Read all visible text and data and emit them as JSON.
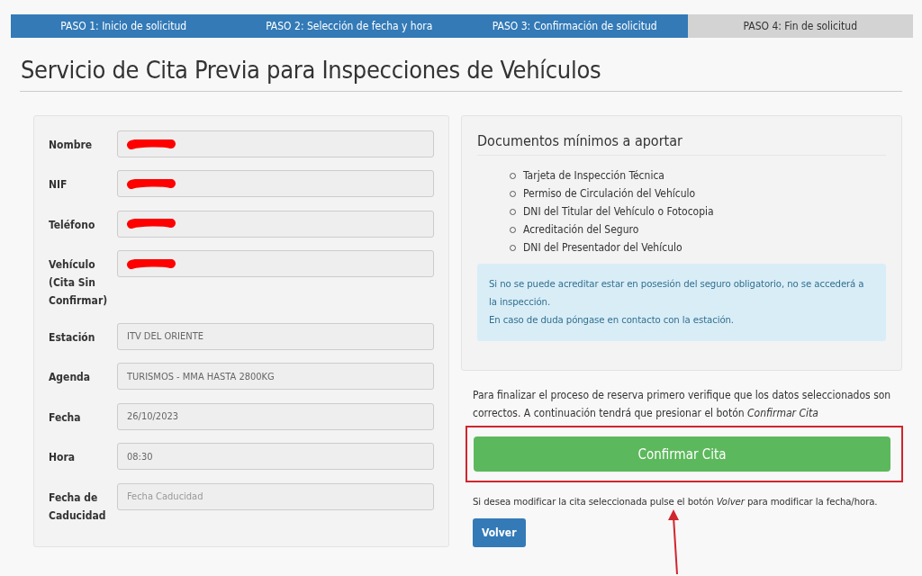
{
  "steps": [
    {
      "label": "PASO 1: Inicio de solicitud",
      "active": true
    },
    {
      "label": "PASO 2: Selección de fecha y hora",
      "active": true
    },
    {
      "label": "PASO 3: Confirmación de solicitud",
      "active": true
    },
    {
      "label": "PASO 4: Fin de solicitud",
      "active": false
    }
  ],
  "title": "Servicio de Cita Previa para Inspecciones de Vehículos",
  "form": [
    {
      "label": "Nombre",
      "redacted": true
    },
    {
      "label": "NIF",
      "redacted": true
    },
    {
      "label": "Teléfono",
      "redacted": true
    },
    {
      "label": "Vehículo (Cita Sin Confirmar)",
      "redacted": true
    },
    {
      "label": "Estación",
      "value": "ITV DEL ORIENTE",
      "redacted": false
    },
    {
      "label": "Agenda",
      "value": "TURISMOS - MMA HASTA 2800KG",
      "redacted": false
    },
    {
      "label": "Fecha",
      "value": "26/10/2023",
      "redacted": false
    },
    {
      "label": "Hora",
      "value": "08:30",
      "redacted": false
    },
    {
      "label": "Fecha de Caducidad",
      "placeholder": "Fecha Caducidad",
      "redacted": false
    }
  ],
  "documents": {
    "heading": "Documentos mínimos a aportar",
    "items": [
      "Tarjeta de Inspección Técnica",
      "Permiso de Circulación del Vehículo",
      "DNI del Titular del Vehículo o Fotocopia",
      "Acreditación del Seguro",
      "DNI del Presentador del Vehículo"
    ],
    "notice": [
      "Si no se puede acreditar estar en posesión del seguro obligatorio, no se accederá a la inspección.",
      "En caso de duda póngase en contacto con la estación."
    ]
  },
  "confirm_text": "Para finalizar el proceso de reserva primero verifique que los datos seleccionados son correctos. A continuación tendrá que presionar el botón *Confirmar Cita*",
  "confirm_button": "Confirmar Cita",
  "back_text": "Si desea modificar la cita seleccionada pulse el botón *Volver* para modificar la fecha/hora.",
  "back_button": "Volver"
}
